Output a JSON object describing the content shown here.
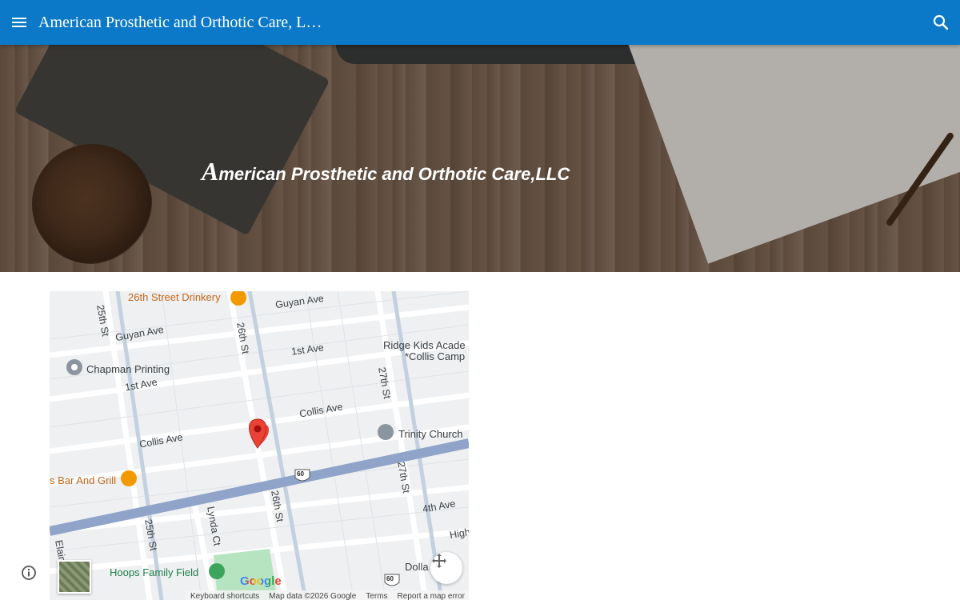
{
  "topbar": {
    "title": "American Prosthetic and Orthotic Care, L…",
    "menu_icon": "menu-icon",
    "search_icon": "search-icon",
    "color": "#0b79c8"
  },
  "hero": {
    "title_cap": "A",
    "title_rest": "merican Prosthetic and Orthotic Care,LLC"
  },
  "map": {
    "streets": {
      "guyan_ave_top": "Guyan Ave",
      "guyan_ave_left": "Guyan Ave",
      "first_ave_right": "1st Ave",
      "first_ave_left": "1st Ave",
      "collis_ave_right": "Collis Ave",
      "collis_ave_left": "Collis Ave",
      "fourth_ave": "4th Ave",
      "high": "High",
      "st25_top": "25th St",
      "st26_top": "26th St",
      "st27_top": "27th St",
      "st27_bottom": "27th St",
      "st26_bottom": "26th St",
      "st25_bottom": "25th St",
      "lynda_ct": "Lynda Ct",
      "elain": "Elain"
    },
    "pois": {
      "drinkery": "26th Street Drinkery",
      "chapman": "Chapman Printing",
      "ridge_kids_1": "Ridge Kids Acade",
      "ridge_kids_2": "*Collis Camp",
      "trinity": "Trinity Church",
      "bar_grill": "s Bar And Grill",
      "hoops": "Hoops Family Field",
      "dollar": "Dolla"
    },
    "route_shield": "60",
    "attribution": {
      "keyboard": "Keyboard shortcuts",
      "map_data": "Map data ©2026 Google",
      "terms": "Terms",
      "report": "Report a map error"
    },
    "google_logo": "Google",
    "colors": {
      "highway": "#8fa4c8",
      "marker": "#ea4335",
      "park": "#b7e4c0"
    }
  },
  "footer": {
    "info_icon": "info-icon"
  }
}
